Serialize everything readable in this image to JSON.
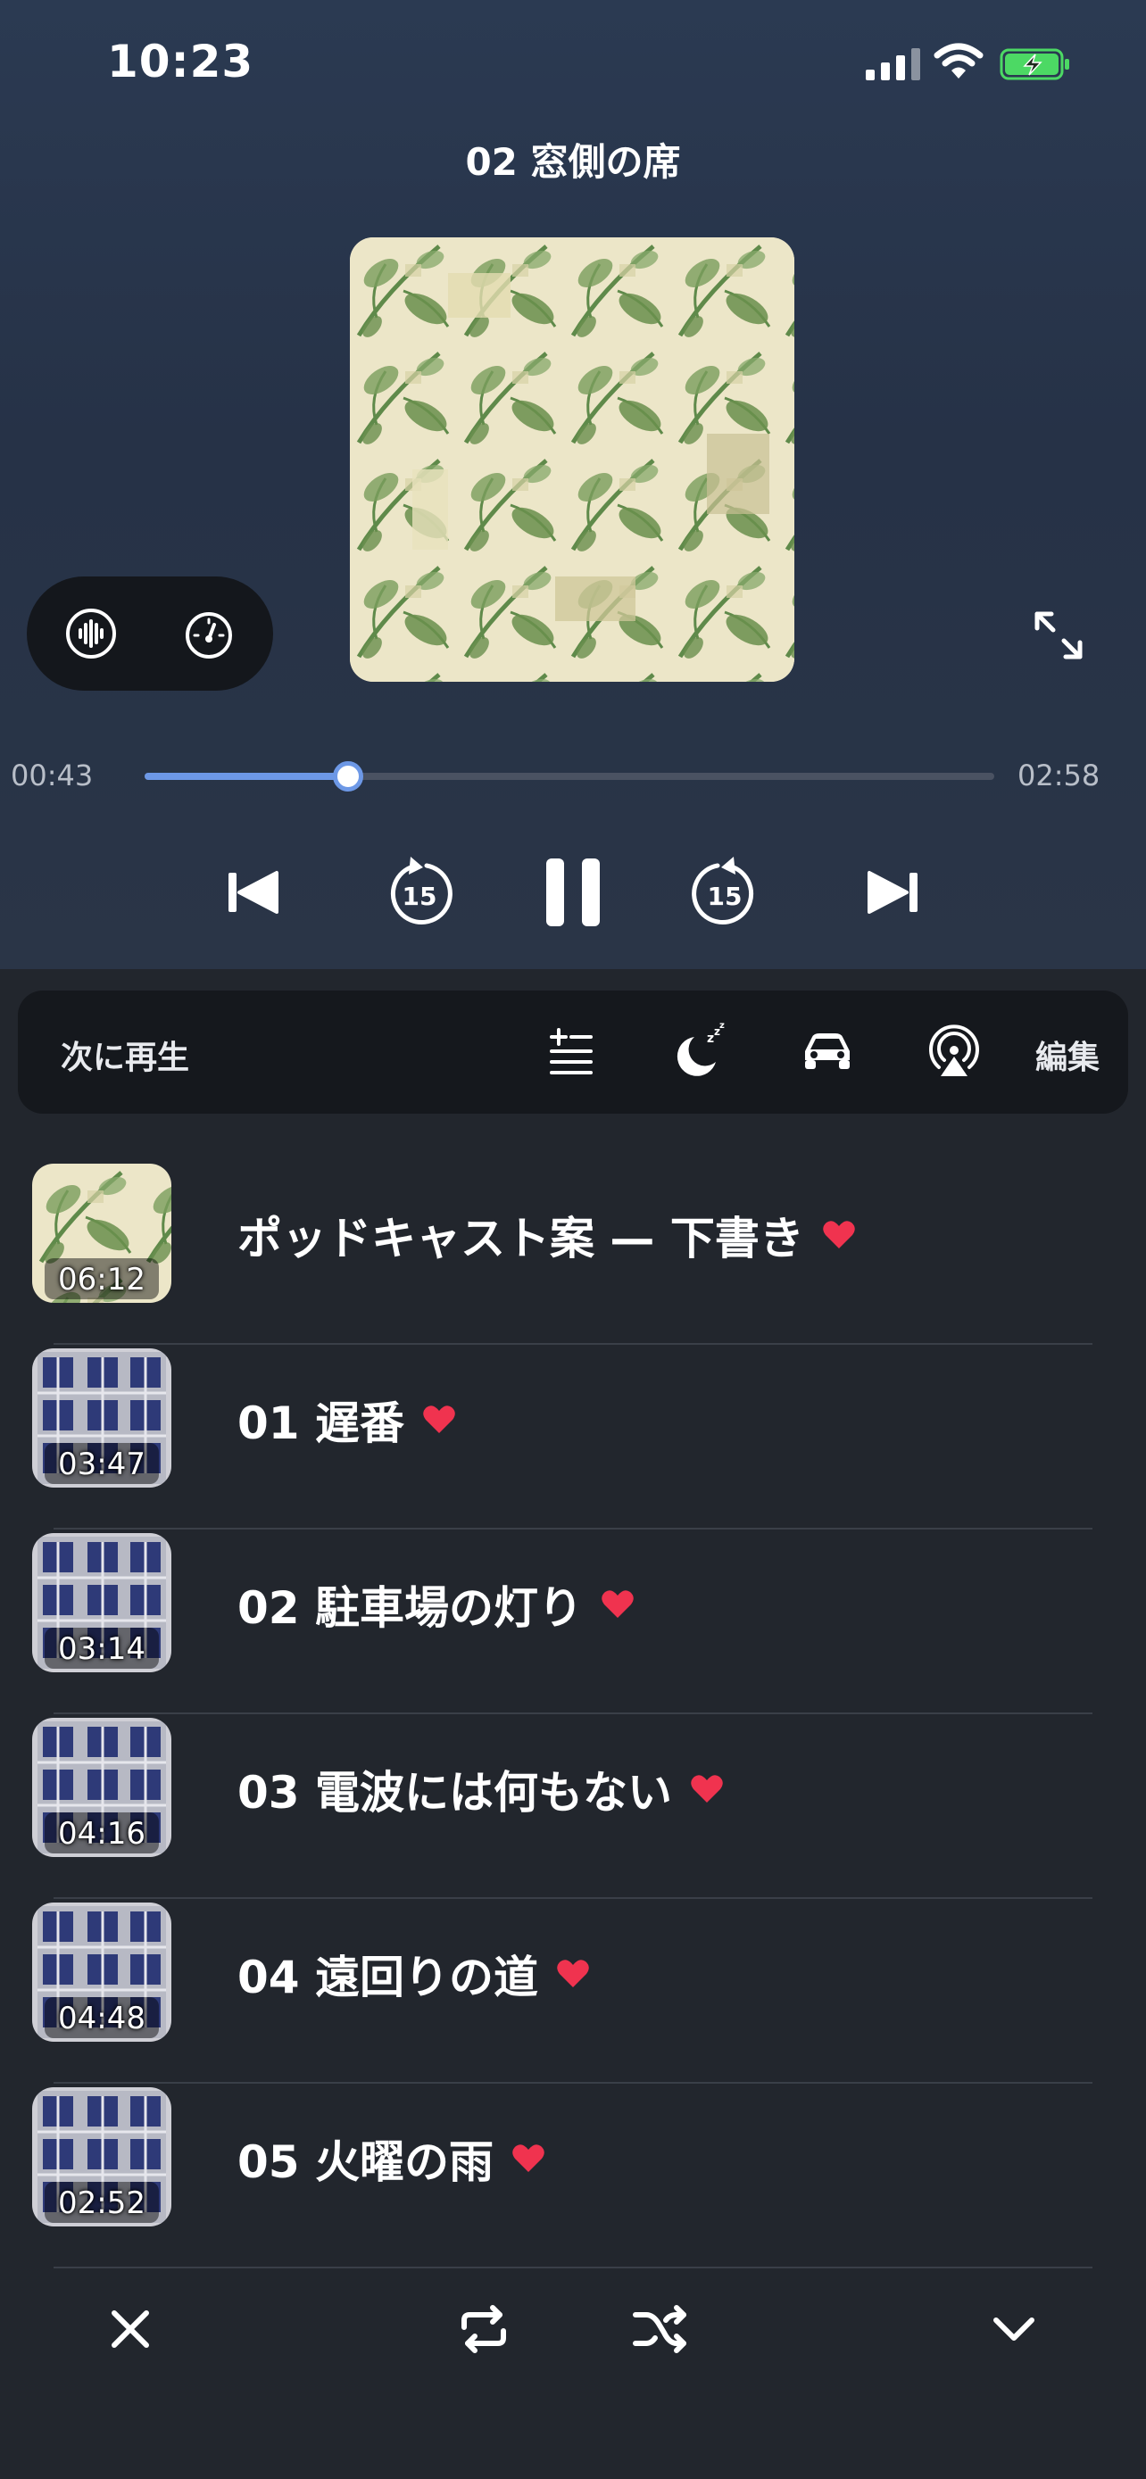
{
  "status_bar": {
    "time": "10:23",
    "signal_icon": "signal-icon",
    "wifi_icon": "wifi-icon",
    "battery_icon": "battery-charging-icon"
  },
  "now_playing": {
    "title": "02 窓側の席",
    "elapsed": "00:43",
    "duration": "02:58",
    "progress_fraction": 0.24
  },
  "controls": {
    "previous": "skip-back-icon",
    "rewind": {
      "icon": "rewind-15-icon",
      "seconds": "15"
    },
    "pause": "pause-icon",
    "forward": {
      "icon": "forward-15-icon",
      "seconds": "15"
    },
    "next": "skip-forward-icon"
  },
  "up_next": {
    "label": "次に再生",
    "edit_label": "編集",
    "icons": [
      "add-to-queue-icon",
      "sleep-timer-icon",
      "car-mode-icon",
      "airplay-icon"
    ]
  },
  "queue": [
    {
      "title": "ポッドキャスト案 — 下書き",
      "duration": "06:12",
      "favorite": true,
      "art": "leaves"
    },
    {
      "title": "01 遅番",
      "duration": "03:47",
      "favorite": true,
      "art": "building"
    },
    {
      "title": "02 駐車場の灯り",
      "duration": "03:14",
      "favorite": true,
      "art": "building"
    },
    {
      "title": "03 電波には何もない",
      "duration": "04:16",
      "favorite": true,
      "art": "building"
    },
    {
      "title": "04 遠回りの道",
      "duration": "04:48",
      "favorite": true,
      "art": "building"
    },
    {
      "title": "05 火曜の雨",
      "duration": "02:52",
      "favorite": true,
      "art": "building"
    }
  ],
  "bottom_bar": {
    "icons": [
      "close-icon",
      "repeat-icon",
      "shuffle-icon",
      "chevron-down-icon"
    ]
  },
  "colors": {
    "accent": "#6d98e6",
    "heart": "#f0334f",
    "background": "#22262d",
    "panel": "#15181d"
  }
}
